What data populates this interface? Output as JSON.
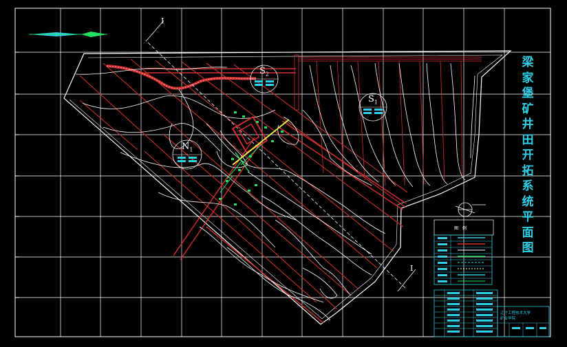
{
  "title_chars": [
    "梁",
    "家",
    "堡",
    "矿",
    "井",
    "田",
    "开",
    "拓",
    "系",
    "统",
    "平",
    "面",
    "图"
  ],
  "district_labels": [
    {
      "main": "S",
      "sub": "2"
    },
    {
      "main": "S",
      "sub": "1"
    },
    {
      "main": "N",
      "sub": "1"
    }
  ],
  "section_markers": [
    "I",
    "I"
  ],
  "legend_header": "图　例",
  "title_block": {
    "line1": "辽宁工程技术大学",
    "line2": "矿业学院"
  },
  "colors": {
    "background": "#000000",
    "grid": "#ffffff",
    "contour": "#ffffff",
    "workings": "#d43030",
    "accent_cyan": "#2fd0e8",
    "accent_green": "#22e060"
  }
}
